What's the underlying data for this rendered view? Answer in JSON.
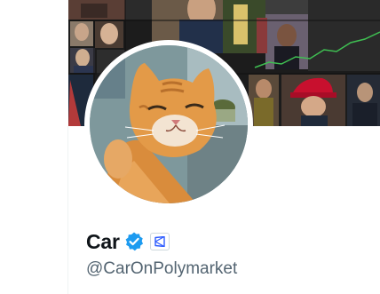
{
  "profile": {
    "display_name": "Car",
    "handle": "@CarOnPolymarket",
    "verified_badge": "verified-checkmark-icon",
    "affiliate_badge": "polymarket-logo-icon"
  },
  "colors": {
    "verified_blue": "#1d9bf0",
    "name_text": "#0f1419",
    "handle_text": "#536471",
    "hat_red": "#c8102e",
    "chart_line_green": "#3fbf52"
  }
}
